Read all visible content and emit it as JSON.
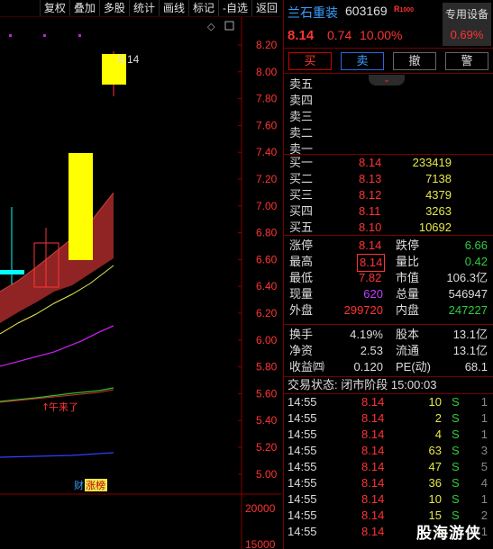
{
  "toolbar": {
    "buttons": [
      "复权",
      "叠加",
      "多股",
      "统计",
      "画线",
      "标记",
      "-自选",
      "返回"
    ]
  },
  "chart": {
    "y_ticks": [
      "8.20",
      "8.00",
      "7.80",
      "7.60",
      "7.40",
      "7.20",
      "7.00",
      "6.80",
      "6.60",
      "6.40",
      "6.20",
      "6.00",
      "5.80",
      "5.60",
      "5.40",
      "5.20",
      "5.00"
    ],
    "volume_ticks": [
      "20000",
      "15000"
    ],
    "high_label": "8.14",
    "annotation": "午来了",
    "tag_cai": "财",
    "tag_zhangbang": "涨榜",
    "colors": {
      "up": "#ffff00",
      "down": "#00ffff",
      "band": "#b03030",
      "ma_purple": "#c020e0",
      "ma_blue": "#3040ff",
      "ma_green": "#30c030"
    }
  },
  "quote": {
    "name": "兰石重装",
    "code": "603169",
    "badge": "R",
    "badge2": "1000",
    "price": "8.14",
    "change": "0.74",
    "change_pct": "10.00%",
    "device_label": "专用设备",
    "device_value": "0.69%"
  },
  "actions": {
    "buy": "买",
    "sell": "卖",
    "cancel": "撤",
    "alert": "警",
    "collapse_icon": "⌄"
  },
  "asks": [
    "卖五",
    "卖四",
    "卖三",
    "卖二",
    "卖一"
  ],
  "bids": [
    {
      "label": "买一",
      "price": "8.14",
      "vol": "233419"
    },
    {
      "label": "买二",
      "price": "8.13",
      "vol": "7138"
    },
    {
      "label": "买三",
      "price": "8.12",
      "vol": "4379"
    },
    {
      "label": "买四",
      "price": "8.11",
      "vol": "3263"
    },
    {
      "label": "买五",
      "price": "8.10",
      "vol": "10692"
    }
  ],
  "stats": {
    "limit_up_label": "涨停",
    "limit_up": "8.14",
    "limit_down_label": "跌停",
    "limit_down": "6.66",
    "high_label": "最高",
    "high": "8.14",
    "ratio_label": "量比",
    "ratio": "0.42",
    "low_label": "最低",
    "low": "7.82",
    "mcap_label": "市值",
    "mcap": "106.3亿",
    "now_label": "现量",
    "now": "620",
    "total_label": "总量",
    "total": "546947",
    "outer_label": "外盘",
    "outer": "299720",
    "inner_label": "内盘",
    "inner": "247227"
  },
  "fin": {
    "turnover_label": "换手",
    "turnover": "4.19%",
    "equity_label": "股本",
    "equity": "13.1亿",
    "nav_label": "净资",
    "nav": "2.53",
    "float_label": "流通",
    "float": "13.1亿",
    "eps_label": "收益㈣",
    "eps": "0.120",
    "pe_label": "PE(动)",
    "pe": "68.1"
  },
  "status": "交易状态: 闭市阶段 15:00:03",
  "ticks": [
    {
      "time": "14:55",
      "price": "8.14",
      "vol": "10",
      "side": "S",
      "count": "1"
    },
    {
      "time": "14:55",
      "price": "8.14",
      "vol": "2",
      "side": "S",
      "count": "1"
    },
    {
      "time": "14:55",
      "price": "8.14",
      "vol": "4",
      "side": "S",
      "count": "1"
    },
    {
      "time": "14:55",
      "price": "8.14",
      "vol": "63",
      "side": "S",
      "count": "3"
    },
    {
      "time": "14:55",
      "price": "8.14",
      "vol": "47",
      "side": "S",
      "count": "5"
    },
    {
      "time": "14:55",
      "price": "8.14",
      "vol": "36",
      "side": "S",
      "count": "4"
    },
    {
      "time": "14:55",
      "price": "8.14",
      "vol": "10",
      "side": "S",
      "count": "1"
    },
    {
      "time": "14:55",
      "price": "8.14",
      "vol": "15",
      "side": "S",
      "count": "2"
    },
    {
      "time": "14:55",
      "price": "8.14",
      "vol": "8",
      "side": "S",
      "count": "1"
    }
  ],
  "watermark": "股海游侠"
}
